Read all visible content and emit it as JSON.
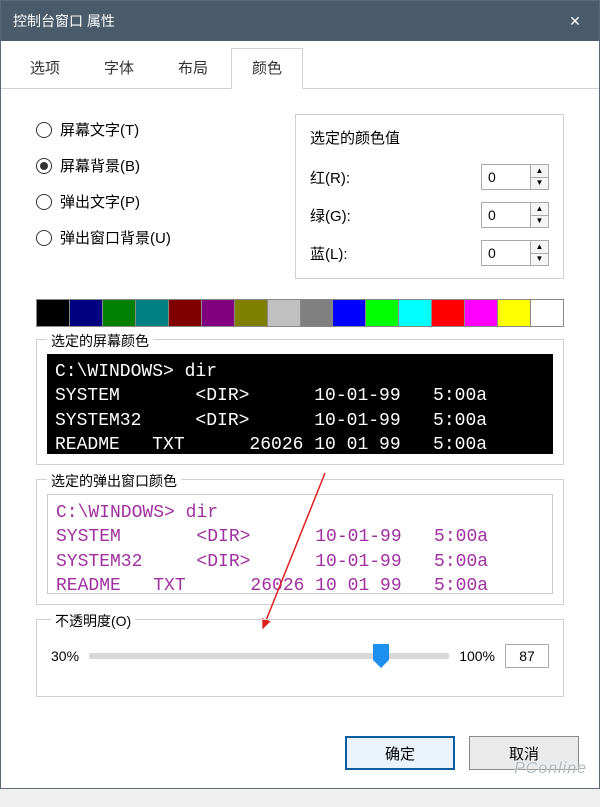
{
  "title": "控制台窗口 属性",
  "tabs": {
    "options": "选项",
    "font": "字体",
    "layout": "布局",
    "colors": "颜色"
  },
  "radios": {
    "screen_text": "屏幕文字(T)",
    "screen_bg": "屏幕背景(B)",
    "popup_text": "弹出文字(P)",
    "popup_bg": "弹出窗口背景(U)"
  },
  "color_values": {
    "title": "选定的颜色值",
    "red_label": "红(R):",
    "green_label": "绿(G):",
    "blue_label": "蓝(L):",
    "red": "0",
    "green": "0",
    "blue": "0"
  },
  "swatches": [
    "#000000",
    "#000080",
    "#008000",
    "#008080",
    "#800000",
    "#800080",
    "#808000",
    "#c0c0c0",
    "#808080",
    "#0000ff",
    "#00ff00",
    "#00ffff",
    "#ff0000",
    "#ff00ff",
    "#ffff00",
    "#ffffff"
  ],
  "previews": {
    "screen_label": "选定的屏幕颜色",
    "popup_label": "选定的弹出窗口颜色",
    "text": "C:\\WINDOWS> dir\nSYSTEM       <DIR>      10-01-99   5:00a\nSYSTEM32     <DIR>      10-01-99   5:00a\nREADME   TXT      26026 10 01 99   5:00a"
  },
  "opacity": {
    "label": "不透明度(O)",
    "min": "30%",
    "max": "100%",
    "value": "87",
    "percent": 81
  },
  "buttons": {
    "ok": "确定",
    "cancel": "取消"
  },
  "watermark": "PConline"
}
